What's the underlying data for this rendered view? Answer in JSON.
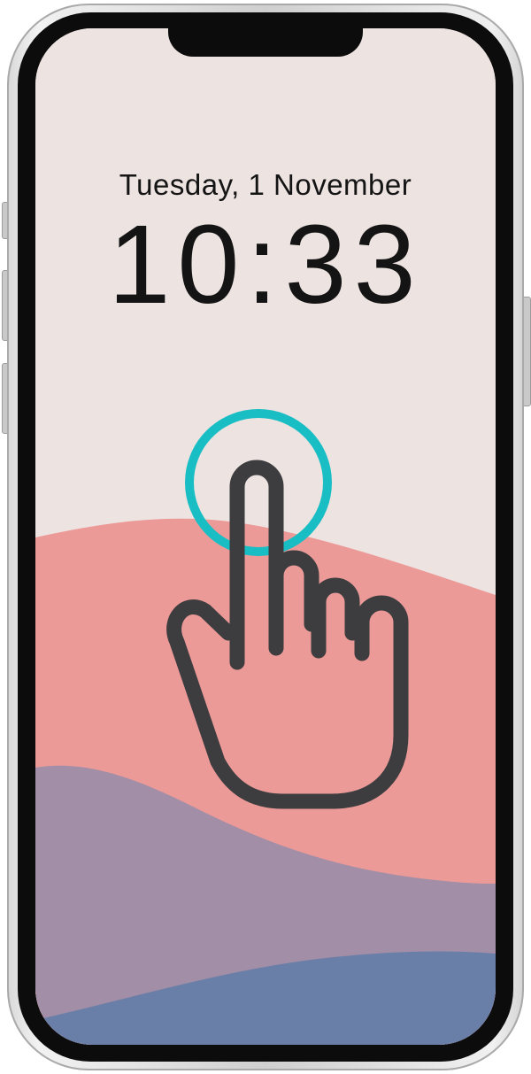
{
  "lock_screen": {
    "date": "Tuesday, 1 November",
    "time": "10:33"
  },
  "gesture": {
    "icon": "tap-hand-icon",
    "indicator": "tap-indicator-ring",
    "ring_color": "#19bec5",
    "hand_color": "#3d3d3f"
  },
  "wallpaper": {
    "colors": [
      "#ede3e1",
      "#ec9a98",
      "#a28ea6",
      "#6a7fa8"
    ]
  }
}
